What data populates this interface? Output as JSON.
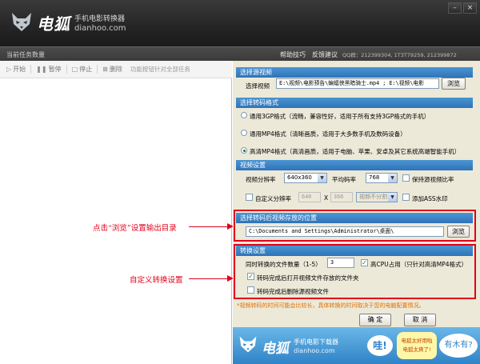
{
  "app": {
    "brand": "电狐",
    "tagline": "手机电影转换器",
    "site": "dianhoo.com",
    "window_minimize": "–",
    "window_close": "×"
  },
  "taskbar": {
    "title": "当前任务数量",
    "help": "帮助技巧",
    "feedback": "反馈建议",
    "qq": "QQ群：212399304, 1T3T79259, 212399872"
  },
  "toolbar": {
    "start": "开始",
    "pause": "暂停",
    "stop": "停止",
    "delete": "删除",
    "hint": "功能按钮针对全部任务"
  },
  "annotations": {
    "browse_hint": "点击“浏览”设置输出目录",
    "custom_hint": "自定义转换设置"
  },
  "select_video": {
    "header": "选择源视频",
    "label": "选择视频",
    "value": "E:\\视频\\电影预告\\蝙蝠侠黑暗骑士.mp4 ; E:\\视频\\电影",
    "browse": "浏览"
  },
  "format": {
    "header": "选择转码格式",
    "options": [
      "通用3GP格式（流畅，兼容性好，适用于所有支持3GP格式的手机）",
      "通用MP4格式（清晰画质，适用于大多数手机及数码设备）",
      "高清MP4格式（高清画质，适用于电脑、苹果、安卓及其它系统高端智能手机）"
    ]
  },
  "video_settings": {
    "header": "视频设置",
    "resolution_label": "视频分辨率",
    "resolution_value": "640x360",
    "bitrate_label": "平均码率",
    "bitrate_value": "768",
    "keep_ratio": "保持源视频比率",
    "custom_res": "自定义分辨率",
    "custom_w": "640",
    "x": "X",
    "custom_h": "360",
    "split": "视频不分割",
    "watermark": "添加ASS水印"
  },
  "output": {
    "header": "选择转码后视频存放的位置",
    "path": "C:\\Documents and Settings\\Administrator\\桌面\\",
    "browse": "浏览"
  },
  "convert": {
    "header": "转换设置",
    "count_label": "同时转换的文件数量（1-5）",
    "count_value": "3",
    "high_cpu": "高CPU占用（只针对高清MP4格式）",
    "open_folder": "转码完成后打开视频文件存放的文件夹",
    "delete_source": "转码完成后删除源视频文件"
  },
  "note": "*视频转码的时间可能会比较长，具体转换的时间取决于您的电脑配置情况。",
  "buttons": {
    "ok": "确 定",
    "cancel": "取 消"
  },
  "banner": {
    "brand": "电狐",
    "tagline": "手机电影下载器",
    "site": "dianhoo.com",
    "wa": "哇!",
    "mid_line1": "电狐太好用啦",
    "mid_line2": "电狐太爽了!",
    "big": "有木有?"
  }
}
